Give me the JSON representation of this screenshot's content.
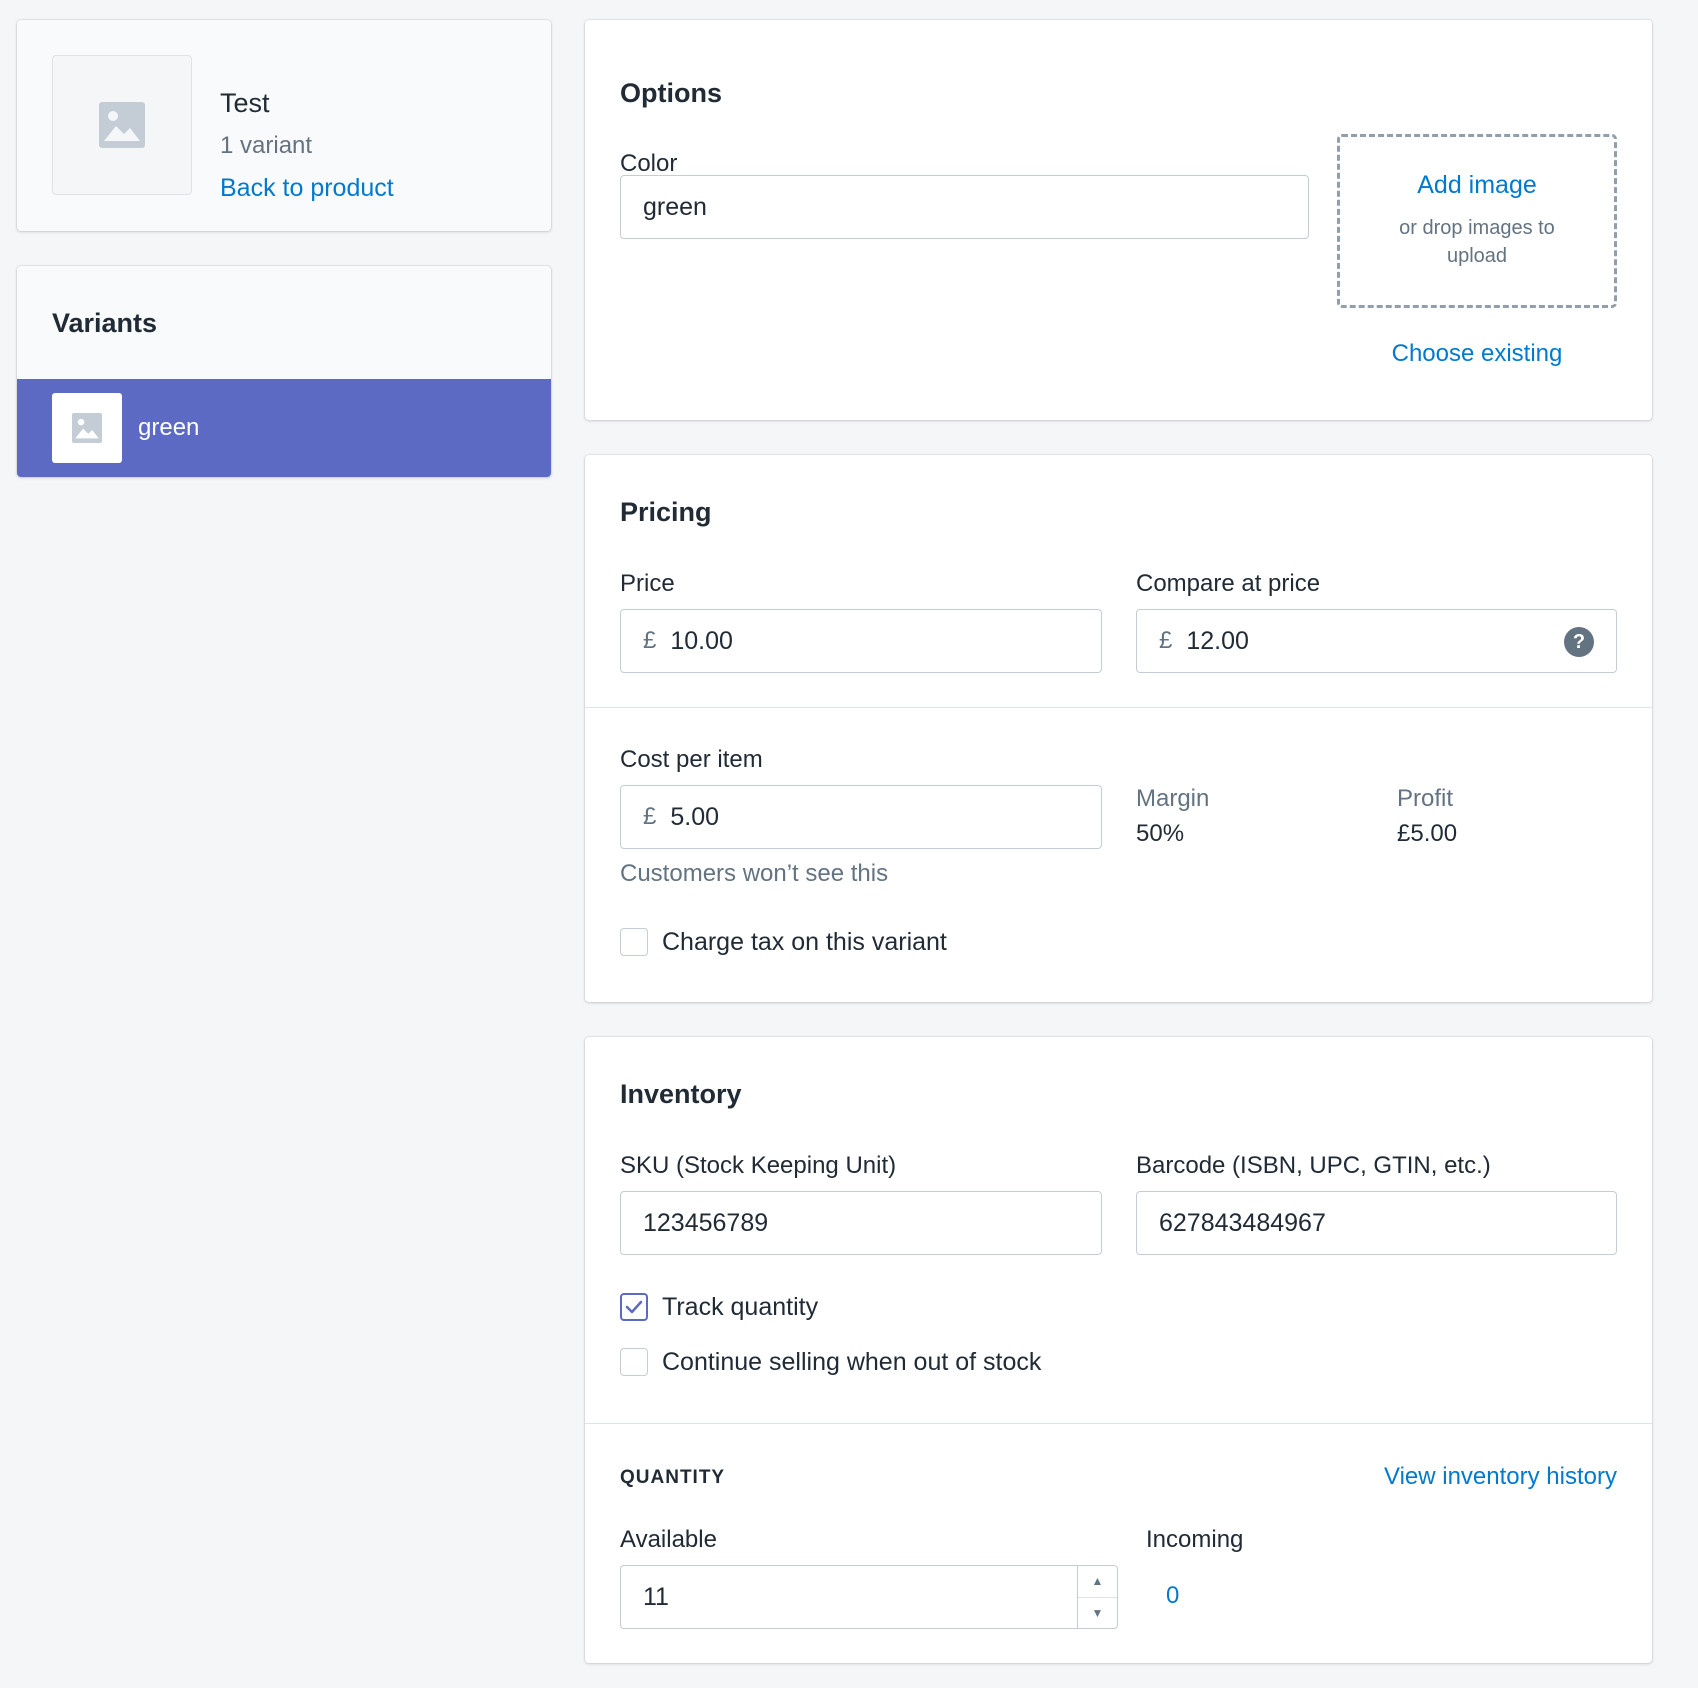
{
  "product": {
    "title": "Test",
    "variant_count": "1 variant",
    "back_link": "Back to product"
  },
  "variants": {
    "title": "Variants",
    "items": [
      {
        "label": "green",
        "selected": true
      }
    ]
  },
  "options": {
    "title": "Options",
    "color_label": "Color",
    "color_value": "green",
    "add_image": "Add image",
    "drop_hint": "or drop images to upload",
    "choose_existing": "Choose existing"
  },
  "pricing": {
    "title": "Pricing",
    "price_label": "Price",
    "price_value": "10.00",
    "compare_label": "Compare at price",
    "compare_value": "12.00",
    "currency_symbol": "£",
    "cost_label": "Cost per item",
    "cost_value": "5.00",
    "cost_hint": "Customers won’t see this",
    "margin_label": "Margin",
    "margin_value": "50%",
    "profit_label": "Profit",
    "profit_value": "£5.00",
    "charge_tax_label": "Charge tax on this variant",
    "charge_tax_checked": false,
    "help_icon": "question-circle-icon"
  },
  "inventory": {
    "title": "Inventory",
    "sku_label": "SKU (Stock Keeping Unit)",
    "sku_value": "123456789",
    "barcode_label": "Barcode (ISBN, UPC, GTIN, etc.)",
    "barcode_value": "627843484967",
    "track_quantity_label": "Track quantity",
    "track_quantity_checked": true,
    "continue_selling_label": "Continue selling when out of stock",
    "continue_selling_checked": false,
    "quantity_heading": "QUANTITY",
    "view_history": "View inventory history",
    "available_label": "Available",
    "available_value": "11",
    "incoming_label": "Incoming",
    "incoming_value": "0"
  },
  "colors": {
    "accent": "#5c6ac4",
    "link": "#007ace",
    "page_background": "#f4f6f8",
    "muted_text": "#637381"
  }
}
